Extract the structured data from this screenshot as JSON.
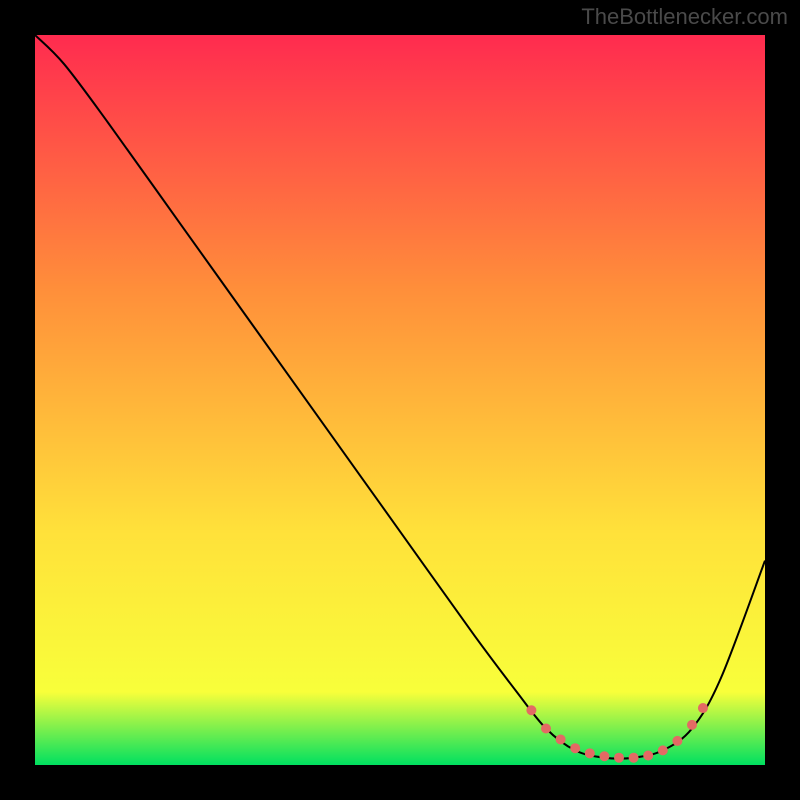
{
  "attribution": "TheBottlenecker.com",
  "chart_data": {
    "type": "line",
    "title": "",
    "xlabel": "",
    "ylabel": "",
    "xlim": [
      0,
      100
    ],
    "ylim": [
      0,
      100
    ],
    "background_gradient": {
      "top": "#ff2b4f",
      "mid_upper": "#ff8f3a",
      "mid": "#ffe13a",
      "mid_lower": "#f8ff3a",
      "bottom": "#00e060"
    },
    "series": [
      {
        "name": "bottleneck-curve",
        "x": [
          0,
          4,
          10,
          20,
          30,
          40,
          50,
          60,
          66,
          70,
          74,
          78,
          82,
          86,
          90,
          94,
          100
        ],
        "y": [
          100,
          96,
          88,
          74,
          60,
          46,
          32,
          18,
          10,
          5,
          2,
          1,
          1,
          2,
          5,
          12,
          28
        ],
        "stroke": "#000000",
        "stroke_width": 2
      }
    ],
    "markers": {
      "name": "optimal-range-dots",
      "color": "#e36a64",
      "radius": 5,
      "points": [
        {
          "x": 68,
          "y": 7.5
        },
        {
          "x": 70,
          "y": 5.0
        },
        {
          "x": 72,
          "y": 3.5
        },
        {
          "x": 74,
          "y": 2.3
        },
        {
          "x": 76,
          "y": 1.6
        },
        {
          "x": 78,
          "y": 1.2
        },
        {
          "x": 80,
          "y": 1.0
        },
        {
          "x": 82,
          "y": 1.0
        },
        {
          "x": 84,
          "y": 1.3
        },
        {
          "x": 86,
          "y": 2.0
        },
        {
          "x": 88,
          "y": 3.3
        },
        {
          "x": 90,
          "y": 5.5
        },
        {
          "x": 91.5,
          "y": 7.8
        }
      ]
    }
  }
}
